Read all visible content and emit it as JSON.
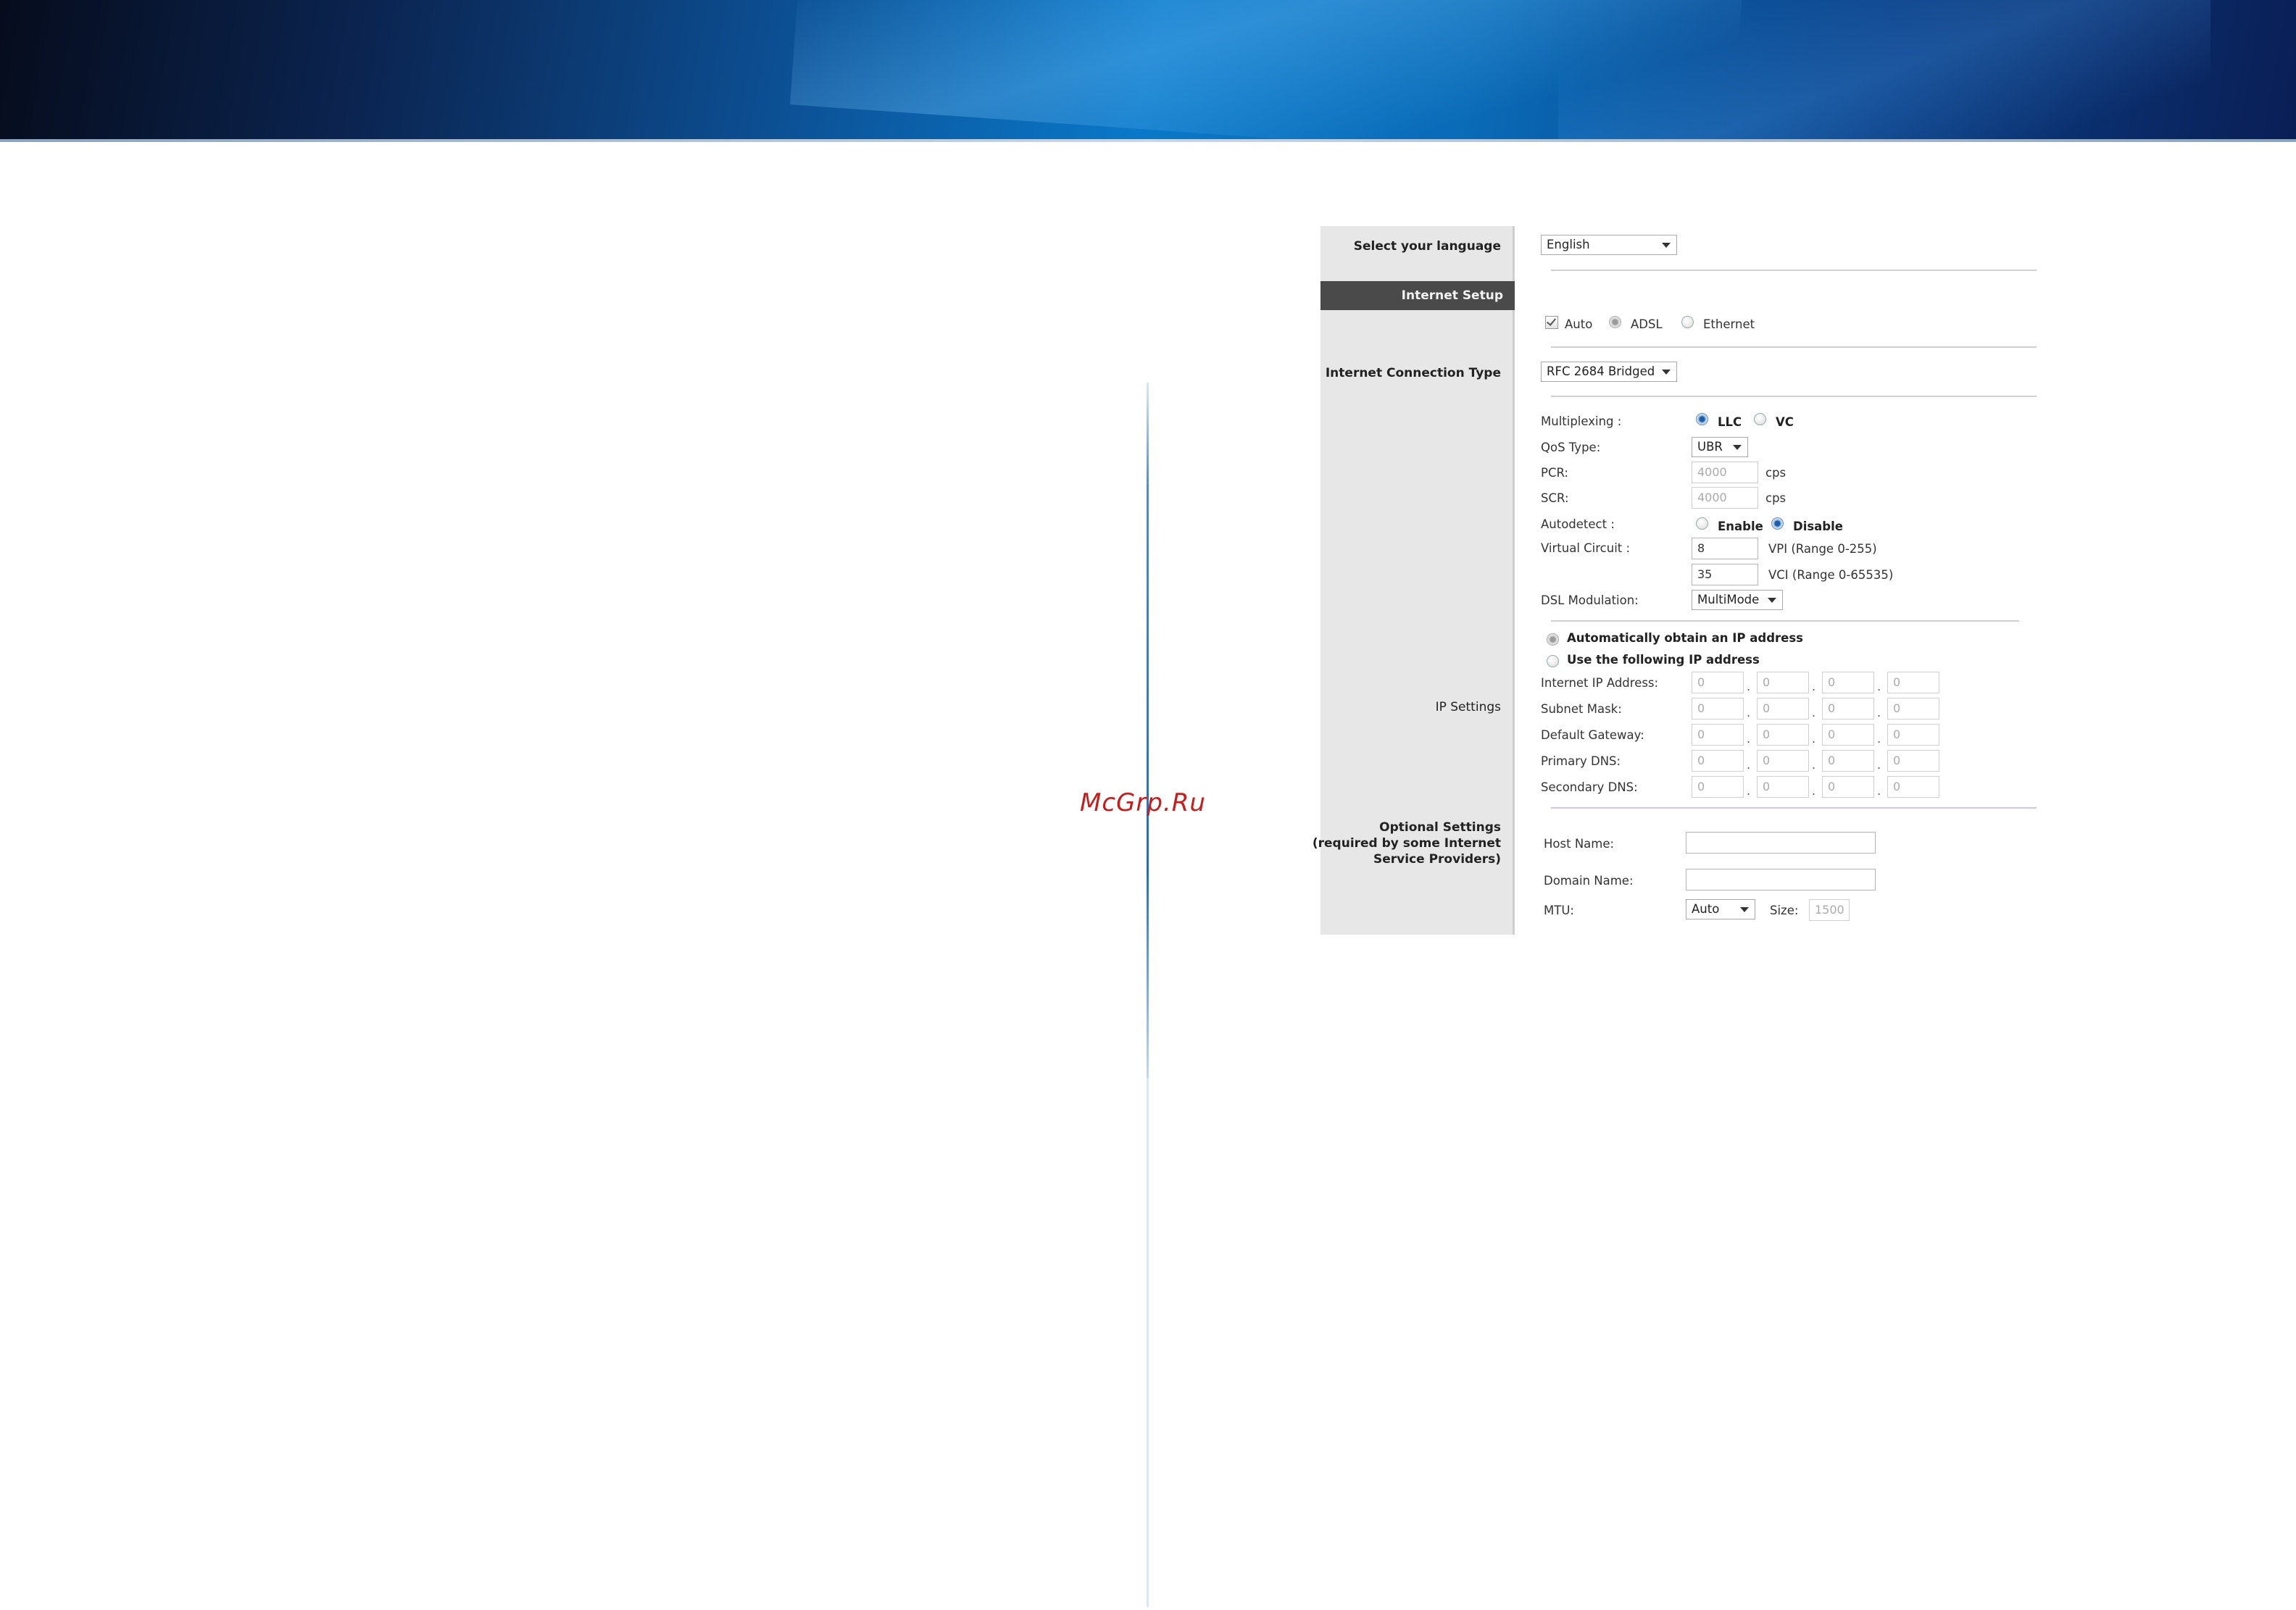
{
  "watermark": "McGrp.Ru",
  "sidebar": {
    "select_language": "Select your language",
    "internet_setup": "Internet Setup",
    "connection_type": "Internet Connection Type",
    "ip_settings": "IP Settings",
    "optional_line1": "Optional Settings",
    "optional_line2": "(required by some Internet",
    "optional_line3": "Service Providers)"
  },
  "language": {
    "selected": "English"
  },
  "detect": {
    "auto_label": "Auto",
    "adsl_label": "ADSL",
    "ethernet_label": "Ethernet",
    "auto_checked": true,
    "selected": "ADSL"
  },
  "connection": {
    "selected": "RFC 2684 Bridged"
  },
  "atm": {
    "multiplexing_label": "Multiplexing :",
    "llc_label": "LLC",
    "vc_label": "VC",
    "multiplexing_selected": "LLC",
    "qos_label": "QoS Type:",
    "qos_value": "UBR",
    "pcr_label": "PCR:",
    "pcr_value": "4000",
    "pcr_unit": "cps",
    "scr_label": "SCR:",
    "scr_value": "4000",
    "scr_unit": "cps",
    "autodetect_label": "Autodetect :",
    "enable_label": "Enable",
    "disable_label": "Disable",
    "autodetect_selected": "Disable",
    "virtual_circuit_label": "Virtual Circuit :",
    "vpi_value": "8",
    "vpi_range": "VPI (Range 0-255)",
    "vci_value": "35",
    "vci_range": "VCI (Range 0-65535)",
    "dsl_modulation_label": "DSL Modulation:",
    "dsl_modulation_value": "MultiMode"
  },
  "ip": {
    "auto_obtain_label": "Automatically obtain an IP address",
    "use_following_label": "Use the following IP address",
    "selected": "auto",
    "fields": [
      {
        "label": "Internet IP Address:",
        "octets": [
          "0",
          "0",
          "0",
          "0"
        ]
      },
      {
        "label": "Subnet Mask:",
        "octets": [
          "0",
          "0",
          "0",
          "0"
        ]
      },
      {
        "label": "Default Gateway:",
        "octets": [
          "0",
          "0",
          "0",
          "0"
        ]
      },
      {
        "label": "Primary DNS:",
        "octets": [
          "0",
          "0",
          "0",
          "0"
        ]
      },
      {
        "label": "Secondary DNS:",
        "octets": [
          "0",
          "0",
          "0",
          "0"
        ]
      }
    ],
    "separator": "."
  },
  "optional": {
    "host_name_label": "Host Name:",
    "host_name_value": "",
    "domain_name_label": "Domain Name:",
    "domain_name_value": "",
    "mtu_label": "MTU:",
    "mtu_value": "Auto",
    "size_label": "Size:",
    "size_value": "1500"
  }
}
